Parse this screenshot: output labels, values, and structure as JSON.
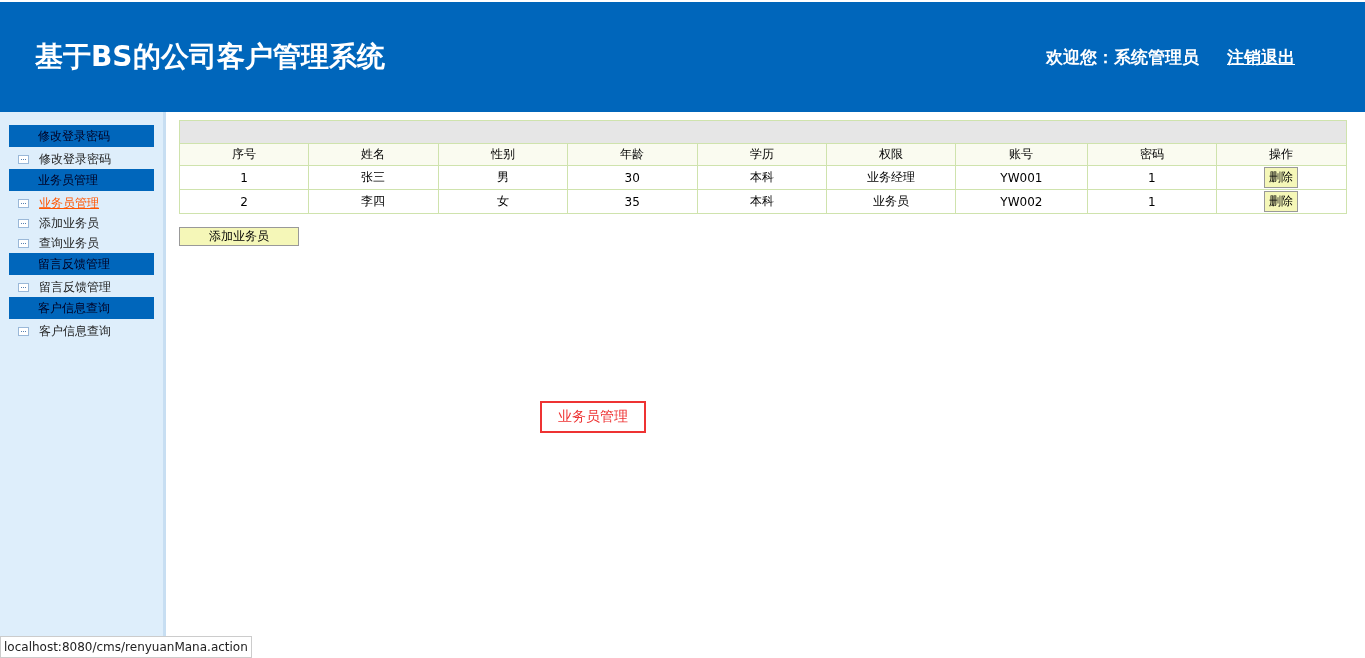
{
  "header": {
    "title": "基于BS的公司客户管理系统",
    "welcome": "欢迎您：系统管理员",
    "logout": "注销退出"
  },
  "sidebar": {
    "groups": [
      {
        "title": "修改登录密码",
        "items": [
          {
            "label": "修改登录密码",
            "selected": false
          }
        ]
      },
      {
        "title": "业务员管理",
        "items": [
          {
            "label": "业务员管理",
            "selected": true
          },
          {
            "label": "添加业务员",
            "selected": false
          },
          {
            "label": "查询业务员",
            "selected": false
          }
        ]
      },
      {
        "title": "留言反馈管理",
        "items": [
          {
            "label": "留言反馈管理",
            "selected": false
          }
        ]
      },
      {
        "title": "客户信息查询",
        "items": [
          {
            "label": "客户信息查询",
            "selected": false
          }
        ]
      }
    ]
  },
  "table": {
    "columns": [
      "序号",
      "姓名",
      "性别",
      "年龄",
      "学历",
      "权限",
      "账号",
      "密码",
      "操作"
    ],
    "rows": [
      {
        "cells": [
          "1",
          "张三",
          "男",
          "30",
          "本科",
          "业务经理",
          "YW001",
          "1"
        ],
        "action": "删除"
      },
      {
        "cells": [
          "2",
          "李四",
          "女",
          "35",
          "本科",
          "业务员",
          "YW002",
          "1"
        ],
        "action": "删除"
      }
    ]
  },
  "add_button": "添加业务员",
  "page_label": "业务员管理",
  "status_bar": "localhost:8080/cms/renyuanMana.action"
}
